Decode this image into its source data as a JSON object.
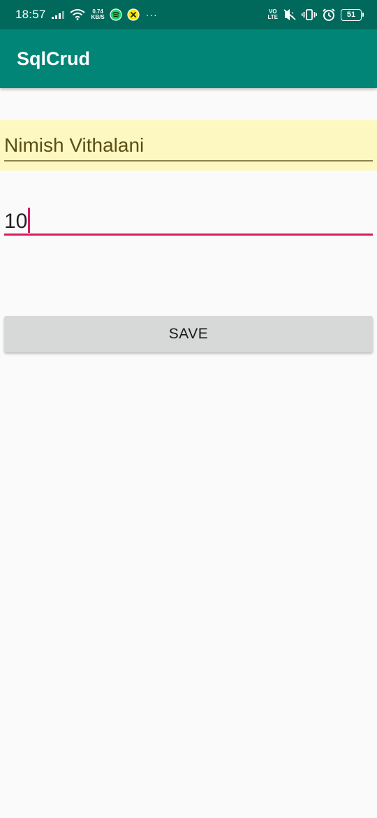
{
  "status_bar": {
    "time": "18:57",
    "net_speed_value": "0.74",
    "net_speed_unit": "KB/S",
    "volte_top": "VO",
    "volte_bottom": "LTE",
    "battery": "51",
    "more": "···",
    "icons": [
      "signal-icon",
      "wifi-icon",
      "spotify-icon",
      "app-notification-icon",
      "volte-icon",
      "vibrate-off-icon",
      "vibrate-icon",
      "alarm-icon",
      "battery-icon"
    ]
  },
  "app_bar": {
    "title": "SqlCrud",
    "color": "#008577"
  },
  "form": {
    "name_value": "Nimish Vithalani",
    "age_value": "10",
    "save_label": "SAVE"
  },
  "colors": {
    "status_bar": "#00695c",
    "accent": "#d81b60",
    "autofill_highlight": "#fdf8c2",
    "button": "#d7d8d8"
  }
}
